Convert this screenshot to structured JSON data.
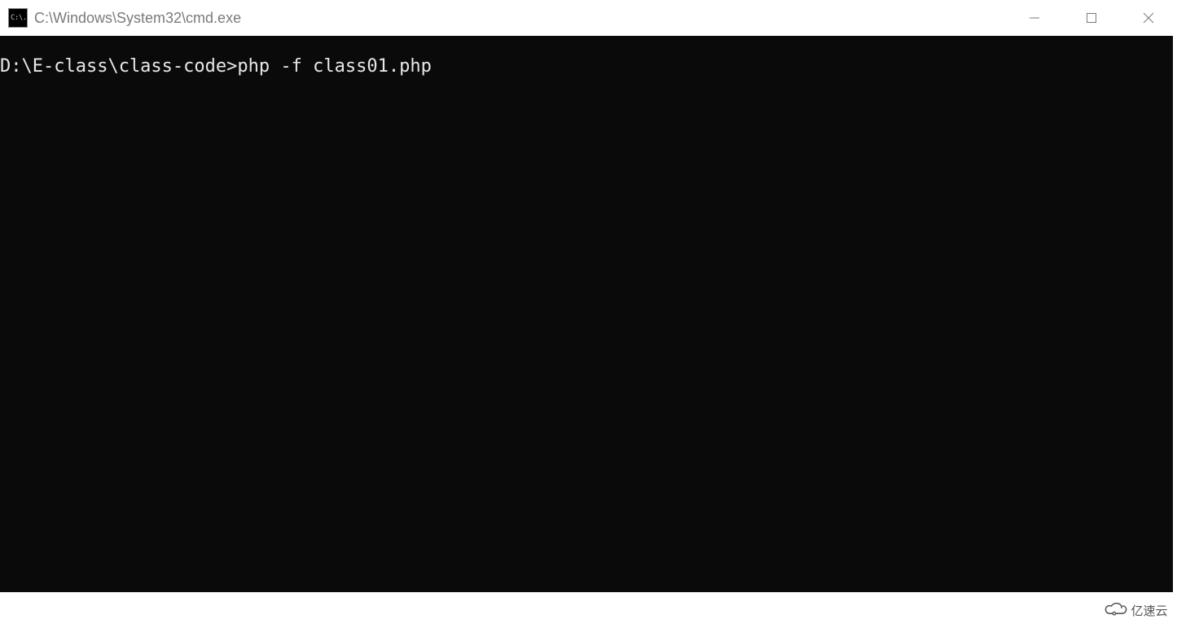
{
  "window": {
    "icon_label": "C:\\.",
    "title": "C:\\Windows\\System32\\cmd.exe"
  },
  "terminal": {
    "prompt": "D:\\E-class\\class-code>",
    "command": "php -f class01.php"
  },
  "watermark": {
    "text": "亿速云"
  }
}
